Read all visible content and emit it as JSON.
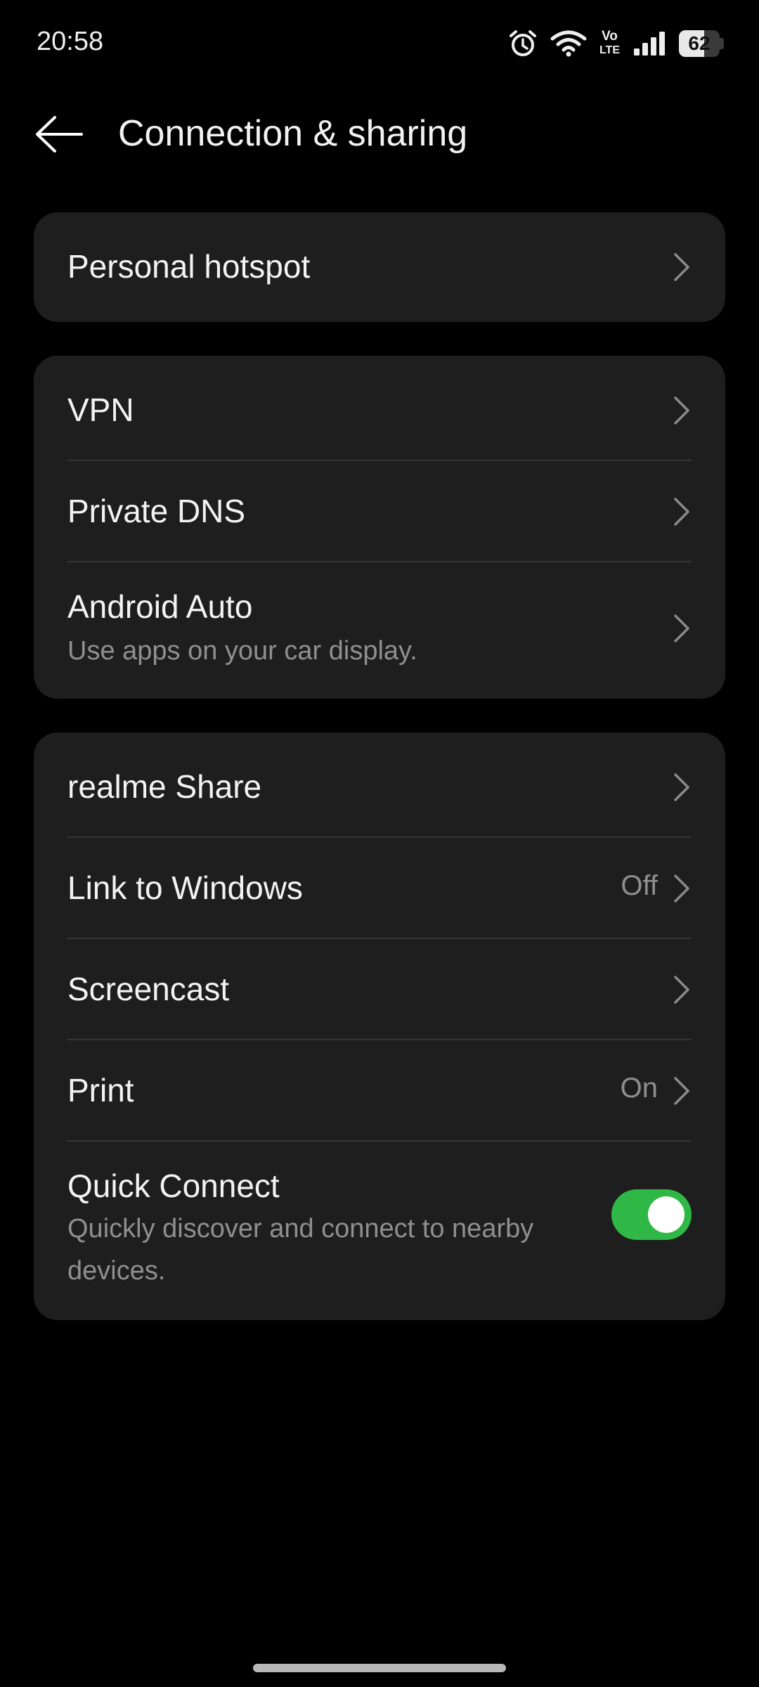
{
  "status_bar": {
    "time": "20:58",
    "battery_level": "62",
    "battery_fraction": 0.62,
    "icons": [
      "alarm-icon",
      "wifi-icon",
      "volte-icon",
      "cellular-signal-icon",
      "battery-icon"
    ],
    "volte_top": "Vo",
    "volte_bottom": "LTE"
  },
  "app_bar": {
    "title": "Connection & sharing",
    "back_icon": "back-arrow-icon"
  },
  "groups": [
    {
      "items": [
        {
          "label": "Personal hotspot"
        }
      ]
    },
    {
      "items": [
        {
          "label": "VPN"
        },
        {
          "label": "Private DNS"
        },
        {
          "label": "Android Auto",
          "subtitle": "Use apps on your car display."
        }
      ]
    },
    {
      "items": [
        {
          "label": "realme Share"
        },
        {
          "label": "Link to Windows",
          "value": "Off"
        },
        {
          "label": "Screencast"
        },
        {
          "label": "Print",
          "value": "On"
        },
        {
          "label": "Quick Connect",
          "subtitle_line1": "Quickly discover and connect to nearby",
          "subtitle_line2": "devices.",
          "toggle_on": true
        }
      ]
    }
  ],
  "colors": {
    "background": "#000000",
    "card": "#1e1e1e",
    "toggle_on": "#2fb845",
    "secondary_text": "#8f8f8f"
  }
}
